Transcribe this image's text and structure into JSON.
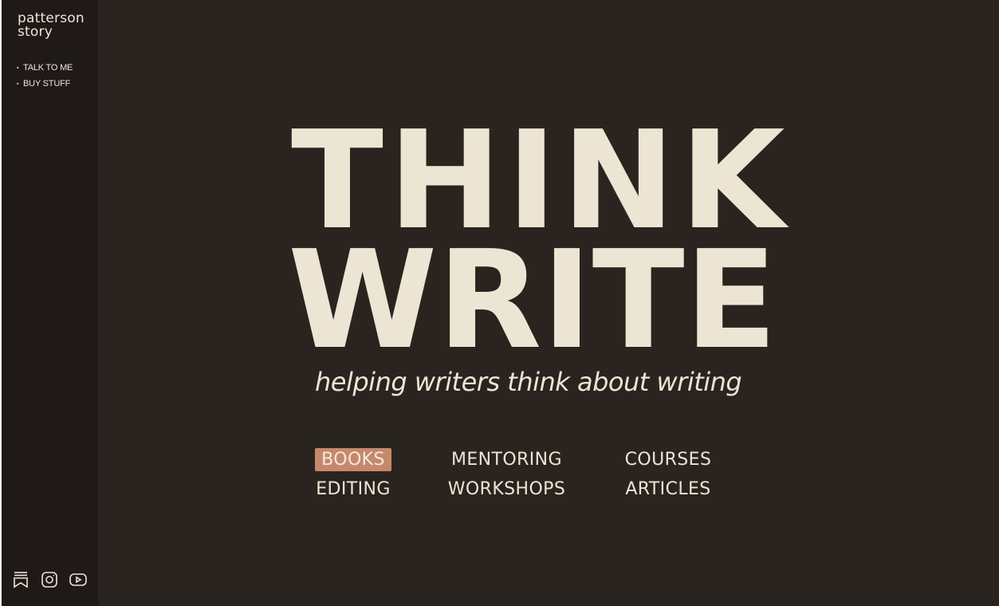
{
  "site": {
    "logo_line1": "patterson",
    "logo_line2": "story"
  },
  "sidebar": {
    "items": [
      {
        "label": "TALK TO ME",
        "bullet": "▪"
      },
      {
        "label": "BUY STUFF",
        "bullet": "▪"
      }
    ],
    "social_icons": [
      "bookmark-stack-icon",
      "instagram-icon",
      "youtube-icon"
    ]
  },
  "hero": {
    "line1": "THINK",
    "line2": "WRITE",
    "tagline": "helping writers think about writing"
  },
  "menu": {
    "items": [
      {
        "label": "BOOKS",
        "active": true
      },
      {
        "label": "MENTORING",
        "active": false
      },
      {
        "label": "COURSES",
        "active": false
      },
      {
        "label": "EDITING",
        "active": false
      },
      {
        "label": "WORKSHOPS",
        "active": false
      },
      {
        "label": "ARTICLES",
        "active": false
      }
    ]
  },
  "colors": {
    "background": "#2a2420",
    "sidebar": "#1f1a17",
    "text": "#ede5d3",
    "accent": "#c6886b"
  }
}
